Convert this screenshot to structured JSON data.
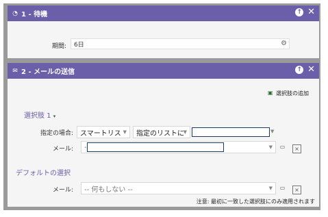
{
  "panel1": {
    "title": "1 - 待機",
    "period_label": "期間:",
    "period_value": "6日"
  },
  "panel2": {
    "title": "2 - メールの送信",
    "add_choice": "選択肢の追加",
    "choice1": {
      "header": "選択肢 1",
      "condition_label": "指定の場合:",
      "condition_field": "スマートリス",
      "condition_operator": "指定のリストに",
      "email_label": "メール:",
      "email_value": "--"
    },
    "default_choice": {
      "header": "デフォルトの選択",
      "email_label": "メール:",
      "email_value": "-- 何もしない --"
    },
    "note": "注意: 最初に一致した選択肢にのみ適用されます"
  }
}
